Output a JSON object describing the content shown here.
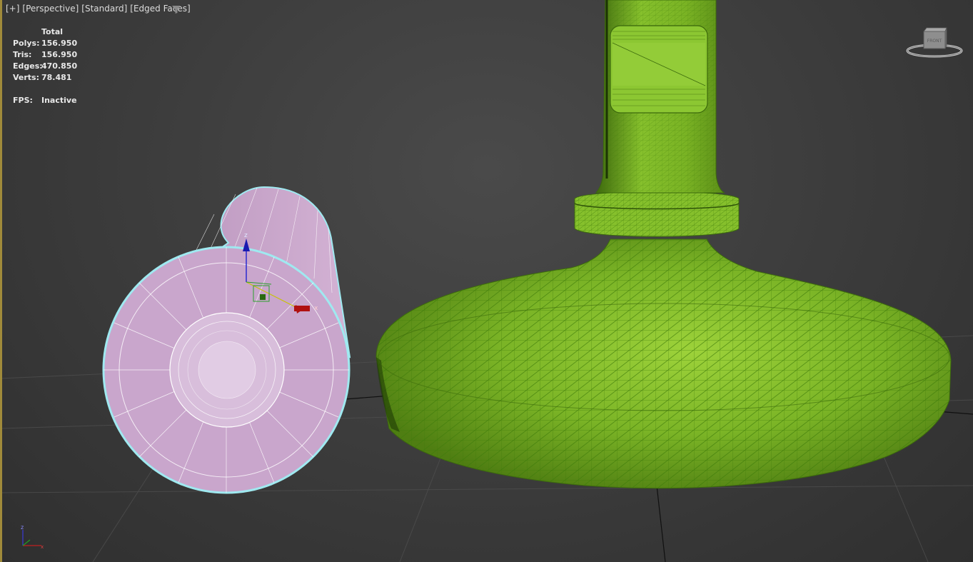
{
  "viewport": {
    "label_parts": [
      "[+]",
      "[Perspective]",
      "[Standard]",
      "[Edged Faces]"
    ]
  },
  "stats": {
    "header": "Total",
    "rows": [
      {
        "key": "Polys:",
        "value": "156.950"
      },
      {
        "key": "Tris:",
        "value": "156.950"
      },
      {
        "key": "Edges:",
        "value": "470.850"
      },
      {
        "key": "Verts:",
        "value": "78.481"
      }
    ],
    "fps_key": "FPS:",
    "fps_value": "Inactive"
  },
  "viewcube": {
    "face_label": "FRONT"
  },
  "colors": {
    "background": "#3b3b3b",
    "selected_object": "#c7a3c9",
    "selection_outline": "#9fe9f0",
    "green_object": "#7ab324",
    "active_border": "#a08a3a",
    "gizmo_z": "#2020c0",
    "gizmo_x": "#b01010",
    "gizmo_y": "#20a020"
  },
  "icons": {
    "viewport_filter": "filter-icon",
    "viewcube": "viewcube-icon",
    "world_axis": "axis-tripod-icon",
    "transform_gizmo": "move-gizmo-icon"
  }
}
